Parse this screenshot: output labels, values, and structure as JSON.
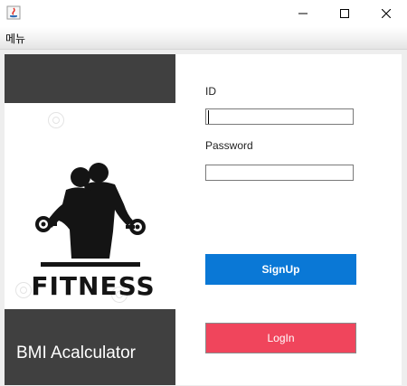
{
  "window": {
    "title": "",
    "controls": [
      "minimize-icon",
      "maximize-icon",
      "close-icon"
    ]
  },
  "menubar": {
    "items": [
      {
        "label": "메뉴"
      }
    ]
  },
  "left_panel": {
    "logo_text": "FITNESS",
    "app_title": "BMI Acalculator"
  },
  "form": {
    "id_label": "ID",
    "id_value": "",
    "password_label": "Password",
    "password_value": "",
    "signup_label": "SignUp",
    "login_label": "LogIn"
  },
  "colors": {
    "dark_panel": "#404040",
    "signup_button": "#0a78d6",
    "login_button": "#f0455c"
  }
}
